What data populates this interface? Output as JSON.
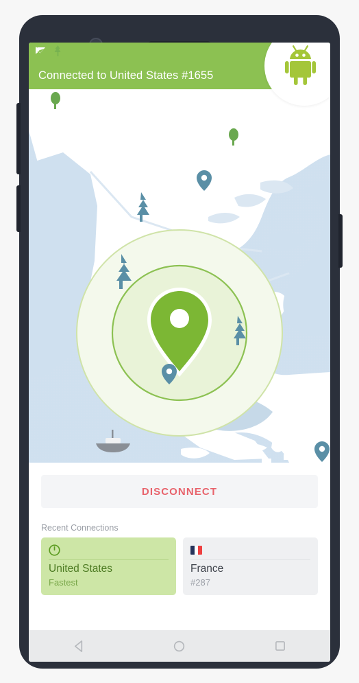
{
  "device": {
    "name": "android-phone-mockup",
    "frame_color": "#2b303b",
    "screen_bg": "#ffffff"
  },
  "badge": {
    "icon": "android-robot-icon",
    "color": "#a4c639"
  },
  "statusbar": {
    "left_icons": [
      "app-notification-icon",
      "tree-decoration-icon"
    ],
    "right_icons": [
      "wifi-icon",
      "cellular-signal-icon"
    ],
    "background": "#8cc152"
  },
  "appbar": {
    "title": "Connected to United States #1655",
    "background": "#8cc152",
    "text_color": "#ffffff"
  },
  "map": {
    "name": "world-map-connection-view",
    "land_color": "#ffffff",
    "water_color": "#cfe0ef",
    "highlight_fill": "#f2f8e8",
    "ring_outer_stroke": "#cfe3a8",
    "ring_inner_stroke": "#8cc152",
    "pin": {
      "label": "active-server-pin",
      "color": "#7cb734",
      "dot_color": "#ffffff"
    },
    "secondary_pins": 3,
    "secondary_pin_color": "#5a8fa6",
    "trees": 6,
    "boat_icon": "ship-icon"
  },
  "panel": {
    "disconnect_label": "DISCONNECT",
    "disconnect_color": "#e8636c",
    "disconnect_bg": "#f4f5f7",
    "recent_label": "Recent Connections",
    "cards": [
      {
        "icon": "power-icon",
        "name": "United States",
        "sub": "Fastest",
        "state": "active",
        "bg": "#cde6a6"
      },
      {
        "icon": "france-flag-icon",
        "name": "France",
        "sub": "#287",
        "state": "inactive",
        "bg": "#eff0f2",
        "flag_colors": [
          "#26335a",
          "#ffffff",
          "#ee4040"
        ]
      }
    ]
  },
  "navbar": {
    "background": "#e9eaeb",
    "buttons": [
      {
        "icon": "back-triangle-icon",
        "label": "Back"
      },
      {
        "icon": "home-circle-icon",
        "label": "Home"
      },
      {
        "icon": "recents-square-icon",
        "label": "Recents"
      }
    ]
  }
}
